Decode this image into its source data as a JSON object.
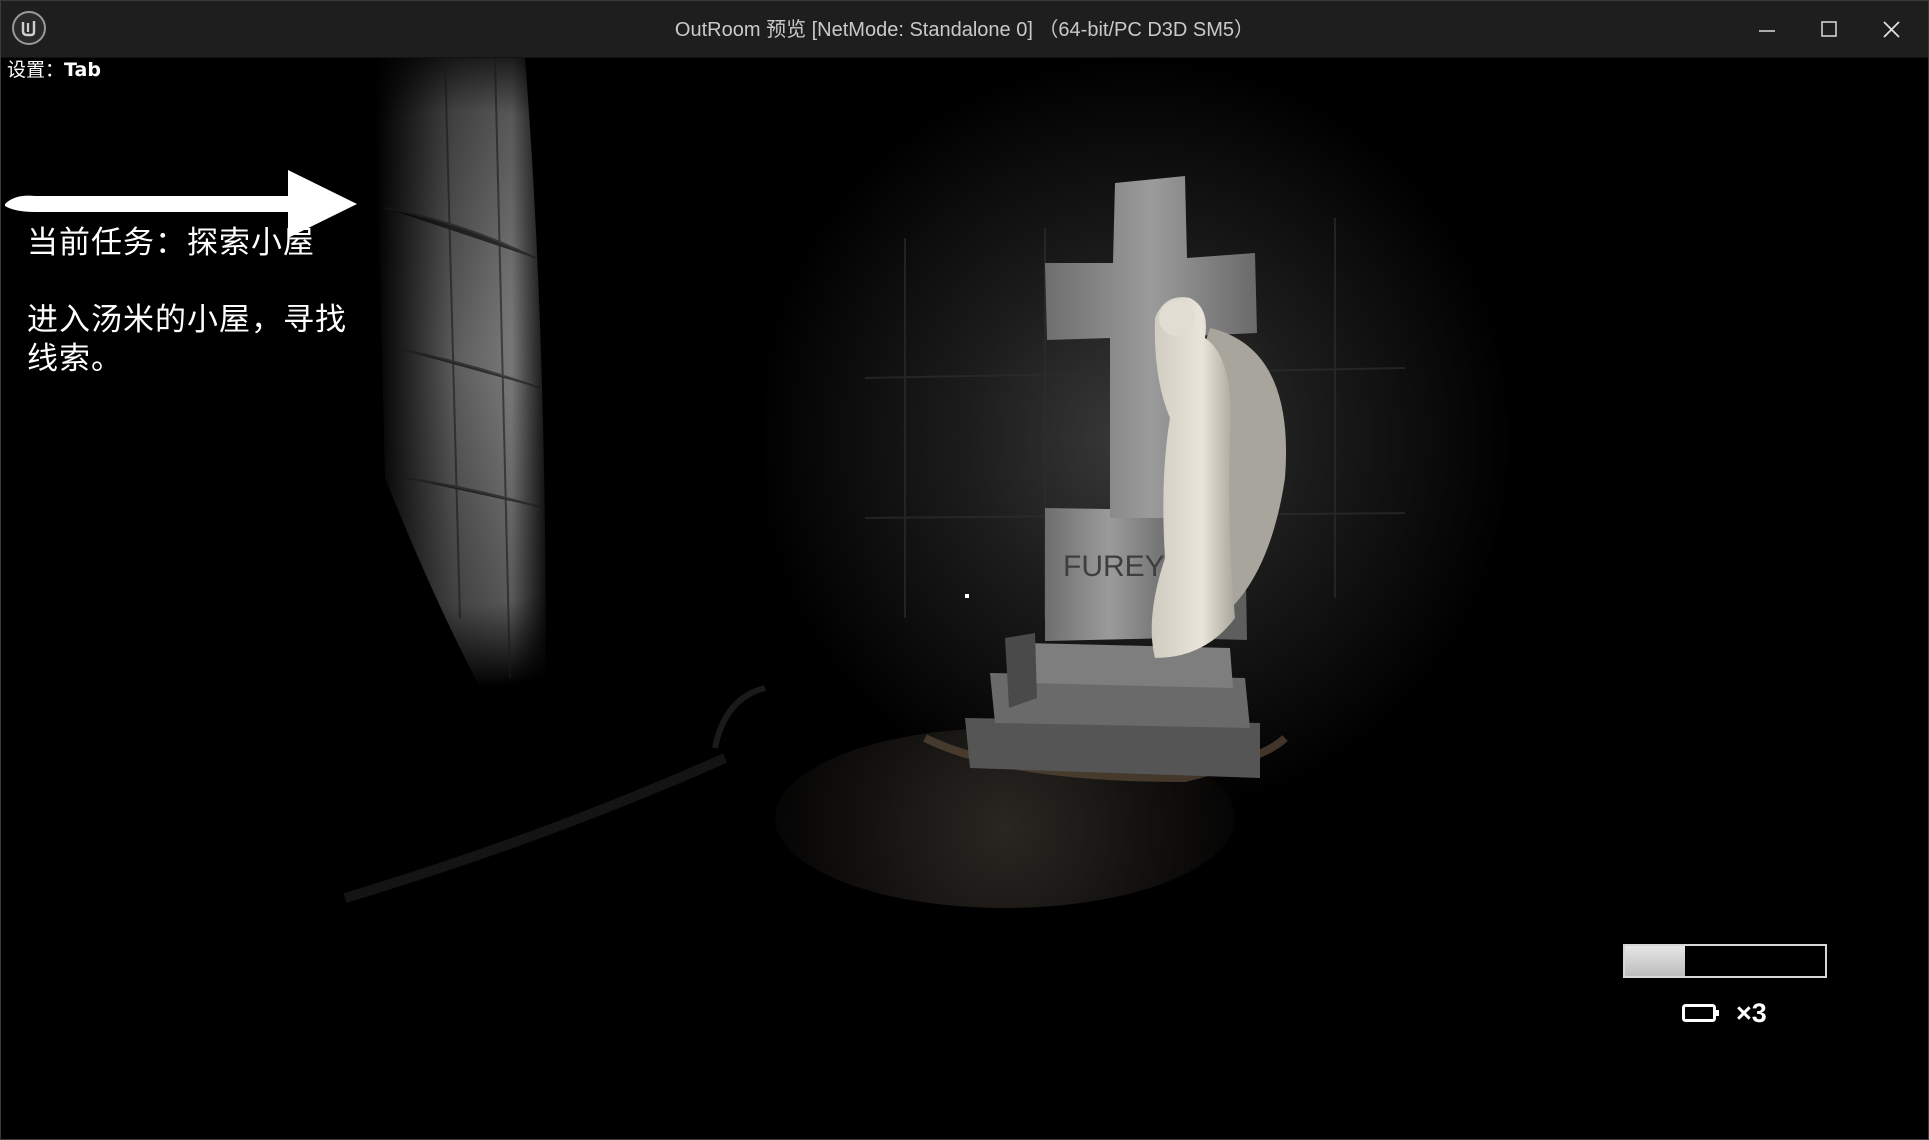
{
  "window": {
    "title": "OutRoom 预览 [NetMode: Standalone 0]  （64-bit/PC D3D SM5）",
    "icons": [
      "unreal-engine-logo",
      "minimize-icon",
      "maximize-icon",
      "close-icon"
    ]
  },
  "hud": {
    "settings_label": "设置：",
    "settings_key": "Tab",
    "quest_title": "当前任务：探索小屋",
    "quest_description": "进入汤米的小屋，寻找线索。",
    "stamina_level": 0.3,
    "battery_count": "×3",
    "icons": [
      "quest-arrow-icon",
      "crosshair",
      "battery-icon"
    ]
  },
  "scene": {
    "gravestone_inscription": "FUREY"
  },
  "colors": {
    "titlebar": "#1e1e1e",
    "hud_text": "#ffffff",
    "background": "#000000"
  }
}
